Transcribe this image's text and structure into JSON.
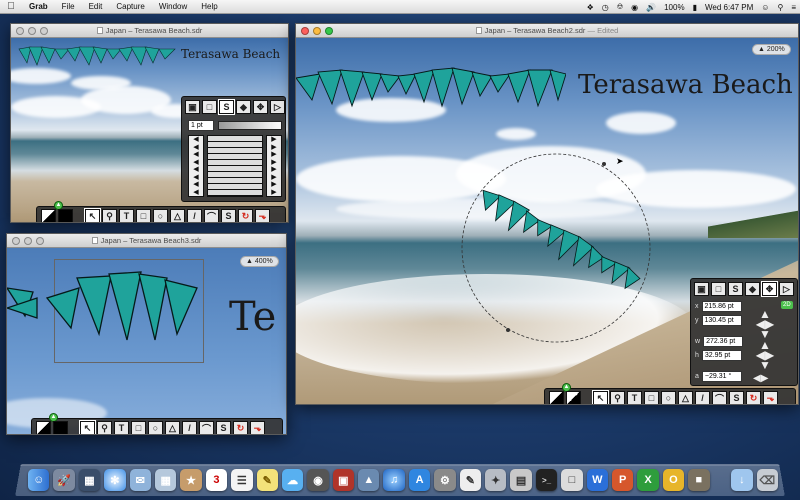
{
  "menubar": {
    "apple": "",
    "app": "Grab",
    "items": [
      "File",
      "Edit",
      "Capture",
      "Window",
      "Help"
    ],
    "battery": "100%",
    "clock": "Wed 6:47 PM"
  },
  "windows": {
    "w1": {
      "title": "Japan – Terasawa Beach.sdr",
      "canvas_title": "Terasawa Beach"
    },
    "w2": {
      "title": "Japan – Terasawa Beach2.sdr",
      "edited": "— Edited",
      "canvas_title": "Terasawa Beach",
      "zoom": "▲ 200%"
    },
    "w3": {
      "title": "Japan – Terasawa Beach3.sdr",
      "canvas_title": "Te",
      "zoom": "▲ 400%"
    }
  },
  "stroke_palette": {
    "width": "1 pt"
  },
  "inspector": {
    "x_label": "x",
    "x": "215.86 pt",
    "y_label": "y",
    "y": "130.45 pt",
    "w_label": "w",
    "w": "272.36 pt",
    "h_label": "h",
    "h": "32.95 pt",
    "a_label": "a",
    "a": "−29.31 °",
    "mode": "2D"
  },
  "tools": {
    "select": "↖",
    "zoom": "🔍",
    "text": "T",
    "rect": "□",
    "oval": "○",
    "triangle": "△",
    "line": "/",
    "arc": "⌒",
    "bezier": "S",
    "rotate": "↻",
    "crop": "⬎"
  },
  "colors": {
    "ribbon": "#1fa39b",
    "accent_green": "#4cbf4c",
    "sky": "#3d6da9"
  }
}
